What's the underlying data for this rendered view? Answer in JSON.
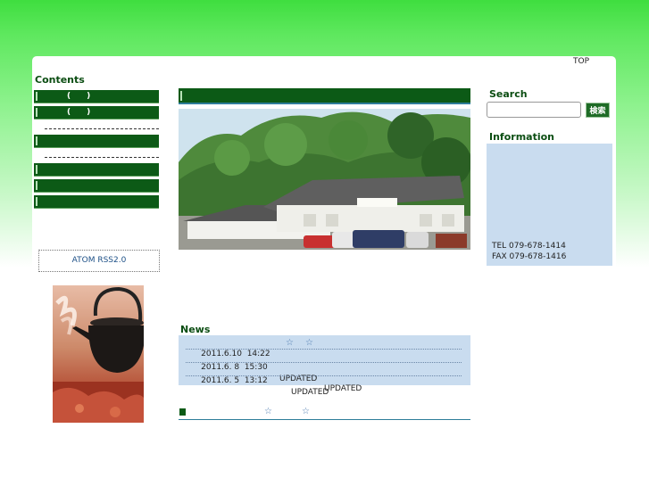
{
  "header": {
    "top_link": "TOP"
  },
  "sidebar": {
    "title": "Contents",
    "items": [
      {
        "label": "(　　)"
      },
      {
        "label": "(　　)"
      },
      {
        "label": ""
      },
      {
        "label": ""
      },
      {
        "label": ""
      },
      {
        "label": ""
      }
    ],
    "feed_label": "ATOM  RSS2.0"
  },
  "news": {
    "title": "News",
    "items": [
      {
        "text": "2011.6.10  14:22",
        "suffix": "UPDATED"
      },
      {
        "text": "2011.6. 8  15:30",
        "suffix": "UPDATED"
      },
      {
        "text": "2011.6. 5  13:12",
        "suffix": "UPDATED"
      }
    ]
  },
  "search": {
    "title": "Search",
    "button": "検索",
    "value": ""
  },
  "info": {
    "title": "Information",
    "tel": "TEL 079-678-1414",
    "fax": "FAX 079-678-1416"
  },
  "icons": {
    "star": "☆"
  },
  "colors": {
    "accent_green": "#0c5a16",
    "info_blue": "#c9dcef",
    "page_green": "#3fde3f"
  }
}
